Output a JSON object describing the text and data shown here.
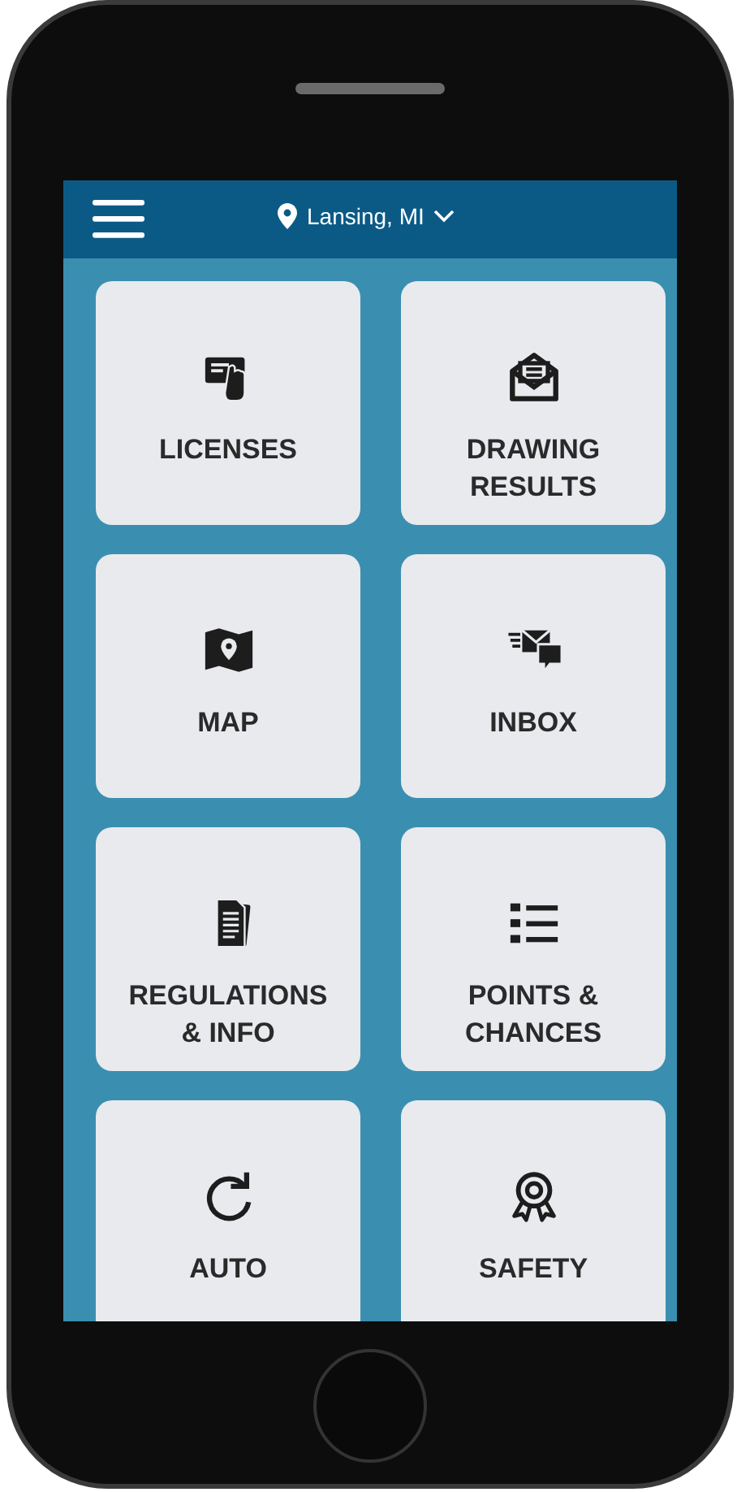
{
  "header": {
    "location": "Lansing, MI"
  },
  "tiles": [
    {
      "label": "LICENSES"
    },
    {
      "label": "DRAWING RESULTS"
    },
    {
      "label": "MAP"
    },
    {
      "label": "INBOX"
    },
    {
      "label": "REGULATIONS & INFO"
    },
    {
      "label": "POINTS & CHANCES"
    },
    {
      "label": "AUTO"
    },
    {
      "label": "SAFETY"
    }
  ]
}
